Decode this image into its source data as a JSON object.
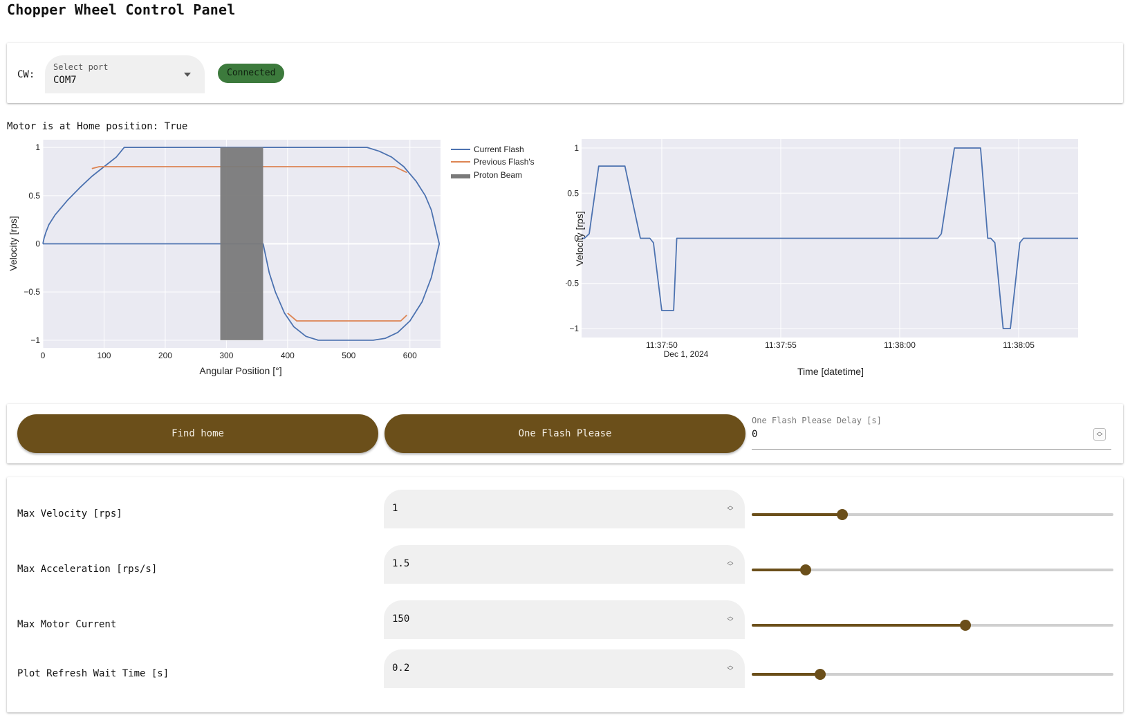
{
  "app": {
    "title": "Chopper Wheel Control Panel"
  },
  "connection": {
    "label": "CW:",
    "port_placeholder": "Select port",
    "port_value": "COM7",
    "status": "Connected",
    "status_color": "#3c7a3c"
  },
  "home_status": "Motor is at Home position: True",
  "colors": {
    "accent": "#6b4f1a",
    "current_flash": "#4c72b0",
    "previous_flash": "#dd8452",
    "proton_beam": "#7a7a7a",
    "plot_bg": "#eaeaf2"
  },
  "chart_data": [
    {
      "type": "line",
      "title": "",
      "xlabel": "Angular Position [°]",
      "ylabel": "Velocity [rps]",
      "xlim": [
        0,
        650
      ],
      "ylim": [
        -1.08,
        1.08
      ],
      "xticks": [
        0,
        100,
        200,
        300,
        400,
        500,
        600
      ],
      "yticks": [
        -1,
        -0.5,
        0,
        0.5,
        1
      ],
      "ytick_labels": [
        "−1",
        "−0.5",
        "0",
        "0.5",
        "1"
      ],
      "grid": true,
      "legend": "right-outside-top",
      "series": [
        {
          "name": "Current Flash",
          "kind": "line",
          "x": [
            0,
            2,
            5,
            10,
            20,
            40,
            60,
            80,
            100,
            120,
            133,
            300,
            530,
            550,
            570,
            590,
            610,
            625,
            635,
            648,
            648,
            635,
            620,
            600,
            580,
            560,
            540,
            450,
            430,
            410,
            395,
            380,
            370,
            360,
            0
          ],
          "y": [
            0,
            0.06,
            0.12,
            0.2,
            0.3,
            0.45,
            0.58,
            0.7,
            0.8,
            0.9,
            1,
            1,
            1,
            0.96,
            0.9,
            0.8,
            0.65,
            0.5,
            0.35,
            0,
            0,
            -0.35,
            -0.6,
            -0.8,
            -0.92,
            -0.98,
            -1,
            -1,
            -0.96,
            -0.86,
            -0.72,
            -0.5,
            -0.3,
            0,
            0
          ]
        },
        {
          "name": "Previous Flash's",
          "kind": "line",
          "x": [
            80,
            92,
            575,
            595
          ],
          "y": [
            0.78,
            0.8,
            0.8,
            0.74
          ]
        },
        {
          "name": "Previous Flash's",
          "kind": "line",
          "x": [
            400,
            415,
            585,
            595
          ],
          "y": [
            -0.72,
            -0.8,
            -0.8,
            -0.74
          ]
        },
        {
          "name": "Proton Beam",
          "kind": "band",
          "x": [
            290,
            360
          ],
          "y": [
            -1,
            1
          ]
        }
      ]
    },
    {
      "type": "line",
      "title": "",
      "xlabel": "Time [datetime]",
      "ylabel": "Velocity [rps]",
      "xlim": [
        46.63,
        67.5
      ],
      "ylim": [
        -1.1,
        1.1
      ],
      "xticks": [
        50,
        55,
        60,
        65
      ],
      "xtick_labels": [
        "11:37:50",
        "11:37:55",
        "11:38:00",
        "11:38:05"
      ],
      "x_sublabel": "Dec 1, 2024",
      "yticks": [
        -1,
        -0.5,
        0,
        0.5,
        1
      ],
      "ytick_labels": [
        "−1",
        "−0.5",
        "0",
        "0.5",
        "1"
      ],
      "grid": true,
      "series": [
        {
          "name": "Velocity",
          "kind": "line",
          "x": [
            46.63,
            46.75,
            46.95,
            47.35,
            47.65,
            48.3,
            48.45,
            49.1,
            49.5,
            49.65,
            50.0,
            50.12,
            50.5,
            50.63,
            61.6,
            61.75,
            62.3,
            62.8,
            63.4,
            63.7,
            63.83,
            64.0,
            64.35,
            64.65,
            65.05,
            65.2,
            65.5,
            67.5
          ],
          "y": [
            0,
            0,
            0.05,
            0.8,
            0.8,
            0.8,
            0.8,
            0,
            0,
            -0.05,
            -0.8,
            -0.8,
            -0.8,
            0,
            0,
            0.05,
            1,
            1,
            1,
            0,
            0,
            -0.05,
            -1,
            -1,
            -0.05,
            0,
            0,
            0
          ]
        }
      ]
    }
  ],
  "actions": {
    "find_home": "Find home",
    "one_flash": "One Flash Please",
    "delay_label": "One Flash Please Delay [s]",
    "delay_value": "0"
  },
  "settings": [
    {
      "label": "Max Velocity [rps]",
      "value": "1",
      "slider_fraction": 0.25
    },
    {
      "label": "Max Acceleration [rps/s]",
      "value": "1.5",
      "slider_fraction": 0.15
    },
    {
      "label": "Max Motor Current",
      "value": "150",
      "slider_fraction": 0.59
    },
    {
      "label": "Plot Refresh Wait Time [s]",
      "value": "0.2",
      "slider_fraction": 0.19
    }
  ]
}
